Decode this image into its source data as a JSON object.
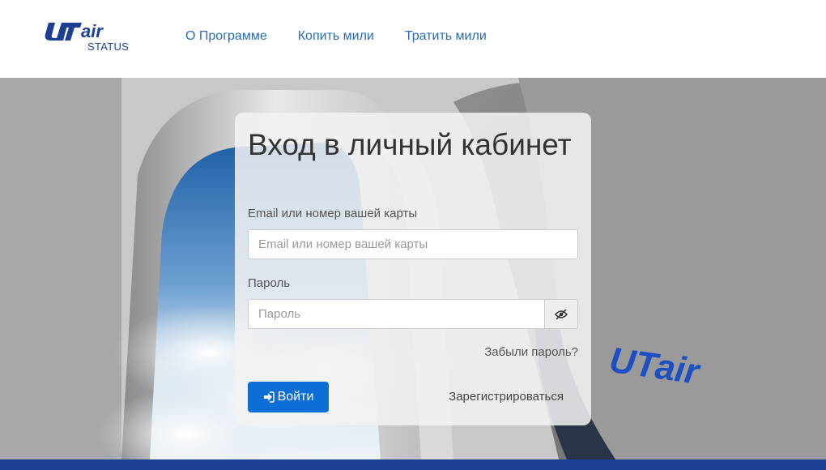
{
  "header": {
    "logo_text": "UTair",
    "logo_subtext": "STATUS",
    "nav": [
      {
        "label": "О Программе"
      },
      {
        "label": "Копить мили"
      },
      {
        "label": "Тратить мили"
      }
    ]
  },
  "hero": {
    "seat_logo_text": "UTair"
  },
  "login": {
    "title": "Вход в личный кабинет",
    "email_label": "Email или номер вашей карты",
    "email_placeholder": "Email или номер вашей карты",
    "email_value": "",
    "password_label": "Пароль",
    "password_placeholder": "Пароль",
    "password_value": "",
    "show_password_icon": "eye-slash-icon",
    "forgot_link": "Забыли пароль?",
    "submit_icon": "sign-in-icon",
    "submit_label": "Войти",
    "register_link": "Зарегистрироваться"
  },
  "colors": {
    "brand": "#1c3f94",
    "link": "#2a6db5",
    "primary_button": "#0d6ed6"
  }
}
